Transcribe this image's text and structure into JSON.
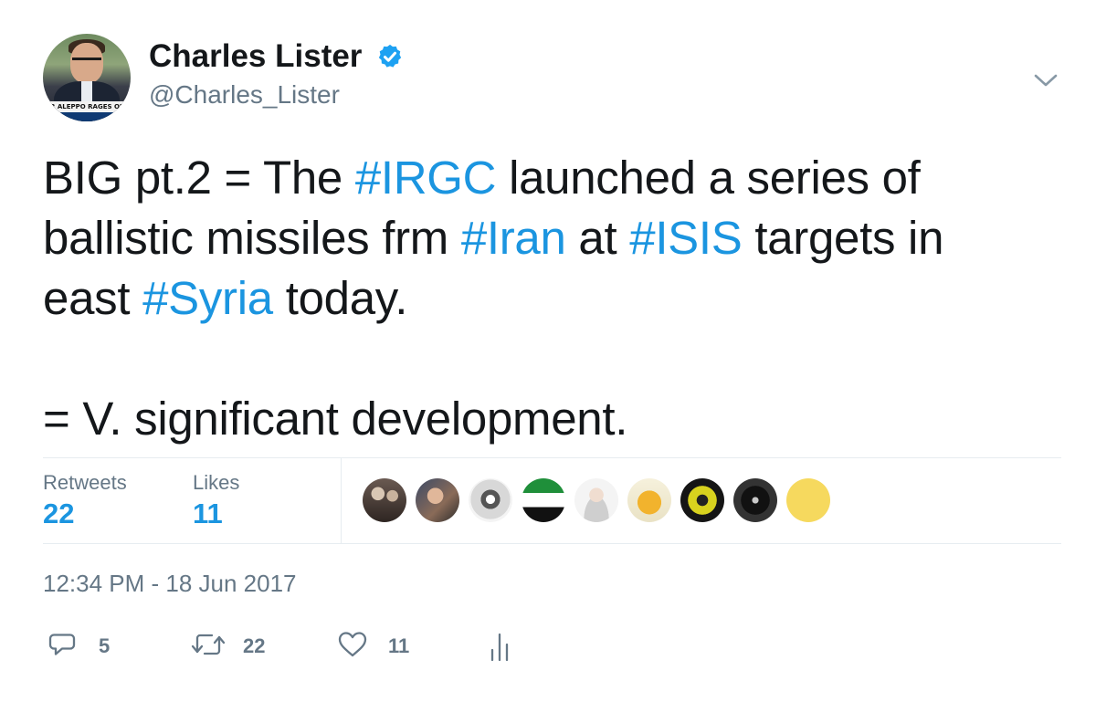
{
  "author": {
    "display_name": "Charles Lister",
    "handle": "@Charles_Lister",
    "avatar_banner_text": "R ALEPPO RAGES ON"
  },
  "tweet": {
    "lines": [
      [
        {
          "text": "BIG pt.2 = The ",
          "hashtag": false
        },
        {
          "text": "#IRGC",
          "hashtag": true
        },
        {
          "text": " launched a series of",
          "hashtag": false
        }
      ],
      [
        {
          "text": "ballistic missiles frm ",
          "hashtag": false
        },
        {
          "text": "#Iran",
          "hashtag": true
        },
        {
          "text": " at ",
          "hashtag": false
        },
        {
          "text": "#ISIS",
          "hashtag": true
        },
        {
          "text": " targets in",
          "hashtag": false
        }
      ],
      [
        {
          "text": "east ",
          "hashtag": false
        },
        {
          "text": "#Syria",
          "hashtag": true
        },
        {
          "text": " today.",
          "hashtag": false
        }
      ],
      [],
      [
        {
          "text": "= V. significant development.",
          "hashtag": false
        }
      ]
    ]
  },
  "stats": {
    "retweets_label": "Retweets",
    "retweets_count": "22",
    "likes_label": "Likes",
    "likes_count": "11"
  },
  "likers": [
    {
      "name": "liker-avatar-1",
      "style": "photo-dark"
    },
    {
      "name": "liker-avatar-2",
      "style": "photo-group"
    },
    {
      "name": "liker-avatar-3",
      "style": "emblem-grey"
    },
    {
      "name": "liker-avatar-4",
      "style": "syrian-flag"
    },
    {
      "name": "liker-avatar-5",
      "style": "photo-portrait"
    },
    {
      "name": "liker-avatar-6",
      "style": "cartoon-yellow"
    },
    {
      "name": "liker-avatar-7",
      "style": "photo-yellow-glasses"
    },
    {
      "name": "liker-avatar-8",
      "style": "emblem-dark"
    },
    {
      "name": "liker-avatar-9",
      "style": "plain-yellow"
    }
  ],
  "timestamp": "12:34 PM - 18 Jun 2017",
  "actions": {
    "reply_count": "5",
    "retweet_count": "22",
    "like_count": "11"
  },
  "colors": {
    "text": "#14171a",
    "secondary": "#657786",
    "link": "#1b95e0",
    "verified": "#1da1f2",
    "divider": "#e6ecf0"
  },
  "icons": {
    "verified": "verified-badge-icon",
    "menu": "chevron-down-icon",
    "reply": "reply-bubble-icon",
    "retweet": "retweet-icon",
    "like": "heart-icon",
    "analytics": "analytics-bars-icon"
  }
}
